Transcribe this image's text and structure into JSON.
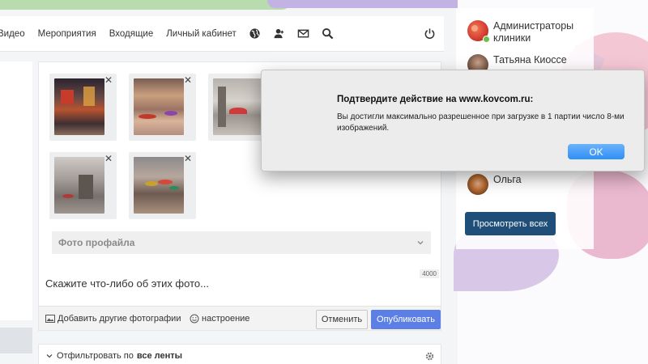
{
  "nav": {
    "items": [
      "Видео",
      "Мероприятия",
      "Входящие",
      "Личный кабинет"
    ]
  },
  "editor": {
    "photos_count": 6,
    "section_label": "Фото профайла",
    "char_counter": "4000",
    "text_placeholder": "Скажите что-либо об этих фото...",
    "add_photos_label": "Добавить другие фотографии",
    "mood_label": "настроение",
    "cancel_label": "Отменить",
    "publish_label": "Опубликовать"
  },
  "filter": {
    "prefix": "Отфильтровать по",
    "value": "все ленты"
  },
  "members": {
    "list": [
      {
        "name_line1": "Администраторы",
        "name_line2": "клиники",
        "online": true
      },
      {
        "name_line1": "Татьяна Киоссе",
        "name_line2": "",
        "online": false
      },
      {
        "name_line1": "Ольга",
        "name_line2": "",
        "online": false
      }
    ],
    "view_all_label": "Просмотреть всех"
  },
  "dialog": {
    "title": "Подтвердите действие на www.kovcom.ru:",
    "message": "Вы достигли максимально разрешенное при загрузке в 1 партии число 8-ми изображений.",
    "ok_label": "OK"
  },
  "colors": {
    "publish": "#5c7fe6",
    "view_all": "#1f4e79",
    "ok_button": "#2f8ff5",
    "online": "#6cc04a"
  },
  "icons": [
    "globe-icon",
    "user-icon",
    "envelope-icon",
    "search-icon",
    "power-icon",
    "picture-icon",
    "smile-icon",
    "gear-icon",
    "chevron-down-icon",
    "close-icon"
  ]
}
